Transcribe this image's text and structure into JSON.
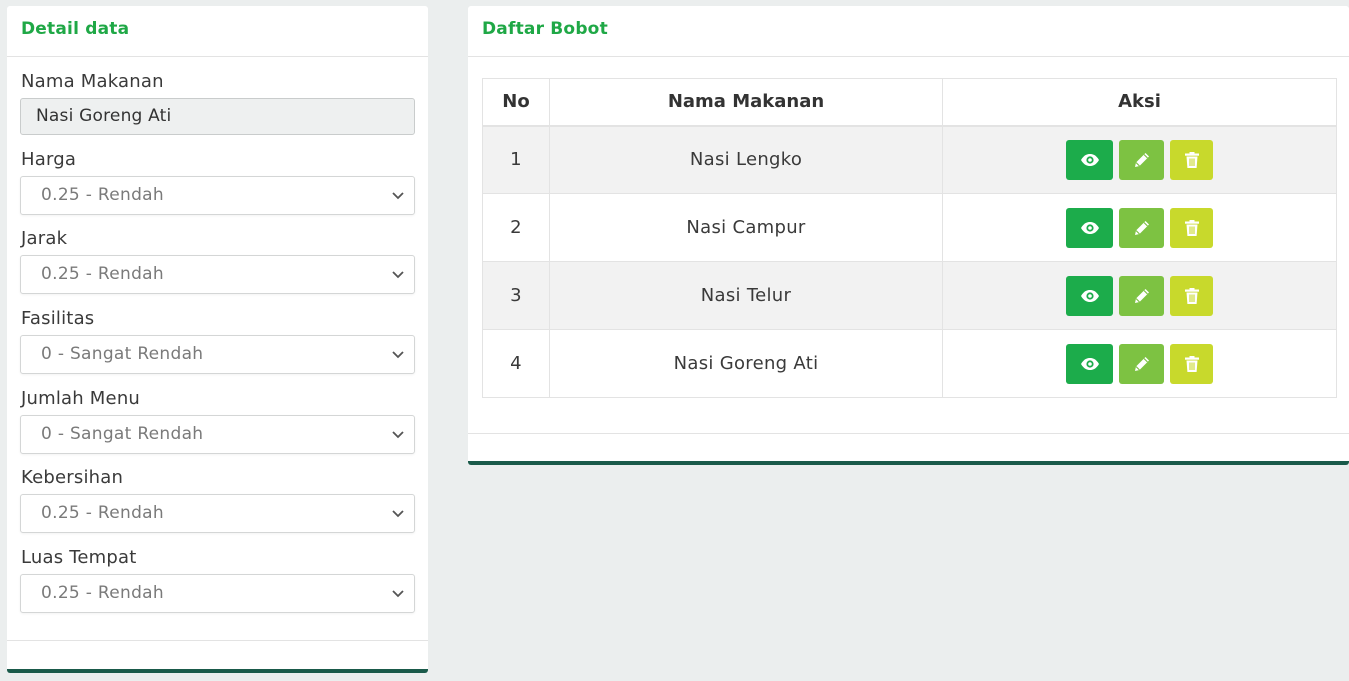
{
  "left_panel": {
    "title": "Detail data",
    "fields": [
      {
        "label": "Nama Makanan",
        "type": "input",
        "value": "Nasi Goreng Ati"
      },
      {
        "label": "Harga",
        "type": "select",
        "value": "0.25 - Rendah"
      },
      {
        "label": "Jarak",
        "type": "select",
        "value": "0.25 - Rendah"
      },
      {
        "label": "Fasilitas",
        "type": "select",
        "value": "0 - Sangat Rendah"
      },
      {
        "label": "Jumlah Menu",
        "type": "select",
        "value": "0 - Sangat Rendah"
      },
      {
        "label": "Kebersihan",
        "type": "select",
        "value": "0.25 - Rendah"
      },
      {
        "label": "Luas Tempat",
        "type": "select",
        "value": "0.25 - Rendah"
      }
    ]
  },
  "right_panel": {
    "title": "Daftar Bobot",
    "table": {
      "headers": [
        "No",
        "Nama Makanan",
        "Aksi"
      ],
      "rows": [
        {
          "no": "1",
          "name": "Nasi Lengko"
        },
        {
          "no": "2",
          "name": "Nasi Campur"
        },
        {
          "no": "3",
          "name": "Nasi Telur"
        },
        {
          "no": "4",
          "name": "Nasi Goreng Ati"
        }
      ]
    },
    "action_icons": [
      "eye-icon",
      "pencil-icon",
      "trash-icon"
    ]
  },
  "colors": {
    "accent_title": "#1fa846",
    "view_button": "#1cac4b",
    "edit_button": "#7dc242",
    "delete_button": "#c8d92c",
    "card_bottom_border": "#1a5a4a"
  }
}
